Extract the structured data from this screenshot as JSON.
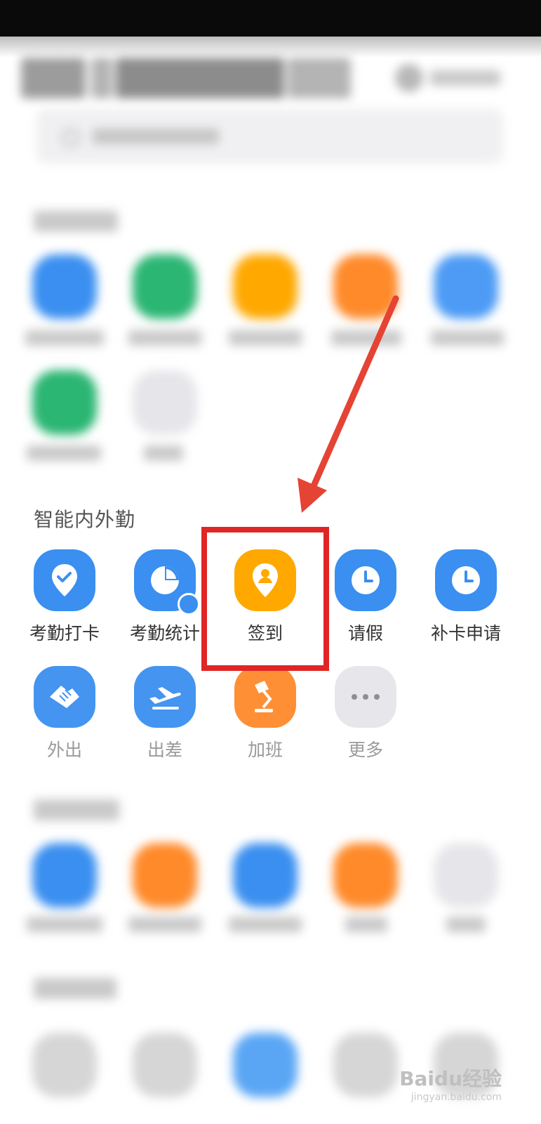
{
  "section": {
    "title": "智能内外勤"
  },
  "apps": [
    {
      "label": "考勤打卡",
      "icon": "location-check-icon",
      "color": "#3a8ff0"
    },
    {
      "label": "考勤统计",
      "icon": "pie-chart-icon",
      "color": "#3a8ff0"
    },
    {
      "label": "签到",
      "icon": "location-person-icon",
      "color": "#ffa800"
    },
    {
      "label": "请假",
      "icon": "clock-icon",
      "color": "#3a8ff0"
    },
    {
      "label": "补卡申请",
      "icon": "clock-icon",
      "color": "#3a8ff0"
    },
    {
      "label": "外出",
      "icon": "handshake-icon",
      "color": "#3a8ff0"
    },
    {
      "label": "出差",
      "icon": "airplane-icon",
      "color": "#3a8ff0"
    },
    {
      "label": "加班",
      "icon": "desk-lamp-icon",
      "color": "#ff8a2a"
    },
    {
      "label": "更多",
      "icon": "more-dots-icon",
      "color": "#e6e6ea"
    }
  ],
  "highlight": {
    "target": "签到",
    "color": "#e02525"
  },
  "watermark": {
    "brand": "Baidu经验",
    "url": "jingyan.baidu.com"
  }
}
